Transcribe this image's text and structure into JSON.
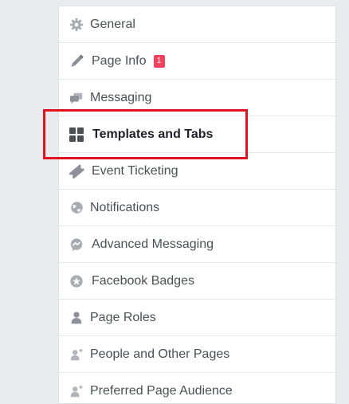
{
  "menu": {
    "items": [
      {
        "id": "general",
        "label": "General",
        "icon": "gear-icon"
      },
      {
        "id": "page-info",
        "label": "Page Info",
        "icon": "pencil-icon",
        "badge": "1"
      },
      {
        "id": "messaging",
        "label": "Messaging",
        "icon": "chat-bubbles-icon"
      },
      {
        "id": "templates-and-tabs",
        "label": "Templates and Tabs",
        "icon": "grid-icon"
      },
      {
        "id": "event-ticketing",
        "label": "Event Ticketing",
        "icon": "ticket-icon"
      },
      {
        "id": "notifications",
        "label": "Notifications",
        "icon": "globe-icon"
      },
      {
        "id": "advanced-messaging",
        "label": "Advanced Messaging",
        "icon": "messenger-icon"
      },
      {
        "id": "facebook-badges",
        "label": "Facebook Badges",
        "icon": "badge-icon"
      },
      {
        "id": "page-roles",
        "label": "Page Roles",
        "icon": "person-icon"
      },
      {
        "id": "people-and-other-pages",
        "label": "People and Other Pages",
        "icon": "person-star-icon"
      },
      {
        "id": "preferred-page-audience",
        "label": "Preferred Page Audience",
        "icon": "person-star-icon"
      }
    ]
  },
  "colors": {
    "highlight_border": "#e0141e",
    "badge": "#f3425f",
    "icon": "#90949c",
    "icon_active": "#4b4f56"
  }
}
